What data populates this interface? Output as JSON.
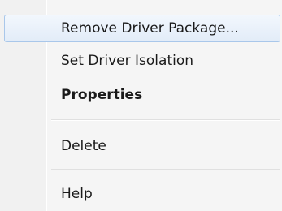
{
  "context_menu": {
    "items": [
      {
        "label": "Remove Driver Package..."
      },
      {
        "label": "Set Driver Isolation"
      },
      {
        "label": "Properties"
      },
      {
        "label": "Delete"
      },
      {
        "label": "Help"
      }
    ]
  }
}
